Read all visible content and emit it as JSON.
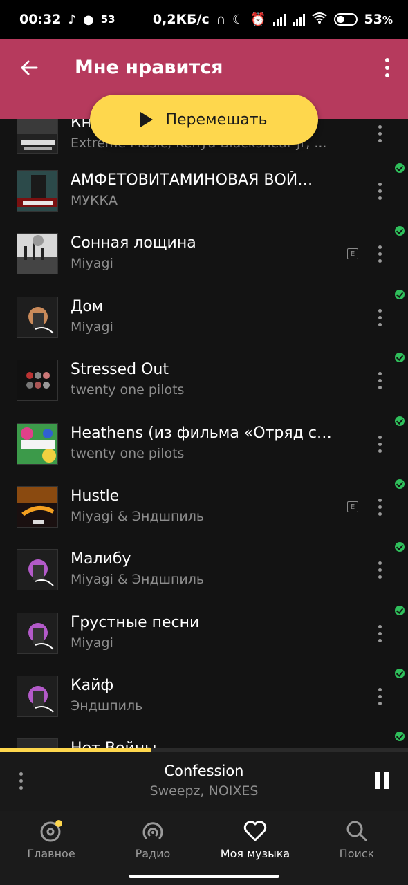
{
  "status_bar": {
    "time": "00:32",
    "notif_count": "53",
    "net_speed": "0,2КБ/с",
    "battery_pct": "53",
    "battery_suffix": "%",
    "battery_level": 0.53
  },
  "header": {
    "title": "Мне нравится",
    "shuffle_label": "Перемешать",
    "color": "#b63a5d",
    "accent": "#fed74d"
  },
  "tracks": [
    {
      "title": "Кн",
      "artist": "Extreme Music, Kenya Blackshear Jr, ...",
      "explicit": false,
      "cover": "cover-urban-country"
    },
    {
      "title": "АМФЕТОВИТАМИНОВАЯ ВОЙ…",
      "artist": "МУККА",
      "explicit": false,
      "cover": "cover-mukka"
    },
    {
      "title": "Сонная лощина",
      "artist": "Miyagi",
      "explicit": true,
      "cover": "cover-factory"
    },
    {
      "title": "Дом",
      "artist": "Miyagi",
      "explicit": false,
      "cover": "cover-hajime"
    },
    {
      "title": "Stressed Out",
      "artist": "twenty one pilots",
      "explicit": false,
      "cover": "cover-blurryface"
    },
    {
      "title": "Heathens (из фильма «Отряд с…",
      "artist": "twenty one pilots",
      "explicit": false,
      "cover": "cover-suicide-squad"
    },
    {
      "title": "Hustle",
      "artist": "Miyagi & Эндшпиль",
      "explicit": true,
      "cover": "cover-hustle"
    },
    {
      "title": "Малибу",
      "artist": "Miyagi & Эндшпиль",
      "explicit": false,
      "cover": "cover-hajime-purple"
    },
    {
      "title": "Грустные песни",
      "artist": "Miyagi",
      "explicit": false,
      "cover": "cover-hajime-purple"
    },
    {
      "title": "Кайф",
      "artist": "Эндшпиль",
      "explicit": false,
      "cover": "cover-hajime-purple"
    },
    {
      "title": "Нет Войны",
      "artist": "",
      "explicit": false,
      "cover": "cover-partial"
    }
  ],
  "explicit_badge": "E",
  "player": {
    "title": "Confession",
    "artist": "Sweepz, NOIXES",
    "progress": 0.37
  },
  "nav": {
    "items": [
      {
        "label": "Главное",
        "icon": "home-disc-icon"
      },
      {
        "label": "Радио",
        "icon": "radio-icon"
      },
      {
        "label": "Моя музыка",
        "icon": "heart-icon"
      },
      {
        "label": "Поиск",
        "icon": "search-icon"
      }
    ],
    "active": 2
  }
}
